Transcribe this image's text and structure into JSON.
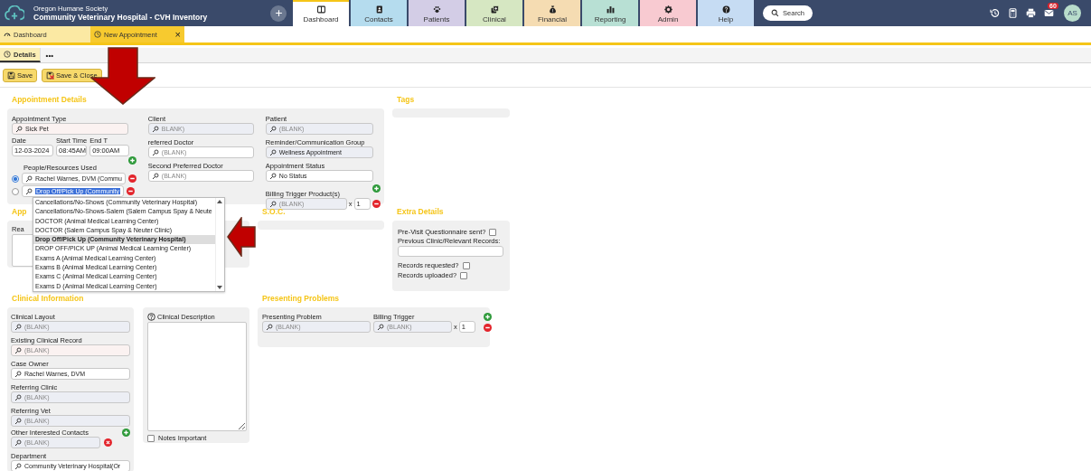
{
  "header": {
    "org": "Oregon Humane Society",
    "site": "Community Veterinary Hospital - CVH Inventory",
    "nav": [
      {
        "label": "Dashboard",
        "selected": true,
        "color": "#ffffff"
      },
      {
        "label": "Contacts",
        "selected": false,
        "color": "#b5dcee"
      },
      {
        "label": "Patients",
        "selected": false,
        "color": "#d3cde6"
      },
      {
        "label": "Clinical",
        "selected": false,
        "color": "#d6e7c2"
      },
      {
        "label": "Financial",
        "selected": false,
        "color": "#f5dcb2"
      },
      {
        "label": "Reporting",
        "selected": false,
        "color": "#b8e0d4"
      },
      {
        "label": "Admin",
        "selected": false,
        "color": "#f8cad1"
      },
      {
        "label": "Help",
        "selected": false,
        "color": "#c6dcf3"
      }
    ],
    "search": "Search",
    "mail_count": "60",
    "avatar": "AS"
  },
  "doc_tabs": [
    {
      "label": "Dashboard",
      "selected": false
    },
    {
      "label": "New Appointment",
      "selected": true,
      "close": "×"
    }
  ],
  "sub_tabs": [
    {
      "label": "Details",
      "selected": true
    }
  ],
  "more": "•••",
  "buttons": [
    {
      "label": "Save",
      "kind": "save"
    },
    {
      "label": "Save & Close",
      "kind": "save-close"
    }
  ],
  "appointment_details": {
    "title": "Appointment Details",
    "appointment_type": {
      "label": "Appointment Type",
      "value": "Sick Pet"
    },
    "date": {
      "label": "Date",
      "value": "12-03-2024"
    },
    "start_time": {
      "label": "Start Time",
      "value": "08:45AM"
    },
    "end_time": {
      "label": "End T",
      "value": "09:00AM"
    },
    "resources": {
      "label": "People/Resources Used",
      "rows": [
        {
          "value": "Rachel Warnes, DVM (Commu",
          "selected": true,
          "highlighted": false
        },
        {
          "value": "Drop Off/Pick Up (Community",
          "selected": false,
          "highlighted": true
        }
      ]
    },
    "client": {
      "label": "Client",
      "placeholder": "BLANK)"
    },
    "preferred_doctor": {
      "label": "referred Doctor",
      "placeholder": "(BLANK)"
    },
    "second_doctor": {
      "label": "Second Preferred Doctor",
      "placeholder": "(BLANK)"
    },
    "patient": {
      "label": "Patient",
      "placeholder": "(BLANK)"
    },
    "reminder_group": {
      "label": "Reminder/Communication Group",
      "value": "Wellness Appointment"
    },
    "status": {
      "label": "Appointment Status",
      "value": "No Status"
    },
    "billing": {
      "label": "Billing Trigger Product(s)",
      "placeholder": "(BLANK)",
      "times": "x",
      "quantity": "1"
    }
  },
  "tags": {
    "title": "Tags"
  },
  "reason": {
    "title": "App",
    "label": "Rea"
  },
  "soc": {
    "title": "S.O.C."
  },
  "extra_details": {
    "title": "Extra Details",
    "questionnaire": {
      "label": "Pre-Visit Questionnaire sent?",
      "checked": false
    },
    "previous_records": {
      "label": "Previous Clinic/Relevant Records:"
    },
    "requested": {
      "label": "Records requested?",
      "checked": false
    },
    "uploaded": {
      "label": "Records uploaded?",
      "checked": false
    }
  },
  "clinical_information": {
    "title": "Clinical Information",
    "fields": [
      {
        "label": "Clinical Layout",
        "placeholder": "(BLANK)",
        "kind": "plain"
      },
      {
        "label": "Existing Clinical Record",
        "placeholder": "(BLANK)",
        "kind": "plain"
      },
      {
        "label": "Case Owner",
        "value": "Rachel Warnes, DVM",
        "kind": "plain"
      },
      {
        "label": "Referring Clinic",
        "placeholder": "(BLANK)",
        "kind": "plain"
      },
      {
        "label": "Referring Vet",
        "placeholder": "(BLANK)",
        "kind": "plain"
      },
      {
        "label": "Other Interested Contacts",
        "placeholder": "(BLANK)",
        "kind": "multi"
      },
      {
        "label": "Department",
        "value": "Community Veterinary Hospital(Or",
        "kind": "plain"
      }
    ]
  },
  "clinical_description": {
    "label": "Clinical Description",
    "notes_important": {
      "label": "Notes Important",
      "checked": false
    }
  },
  "presenting_problems": {
    "title": "Presenting Problems",
    "problem": {
      "label": "Presenting Problem",
      "placeholder": "(BLANK)"
    },
    "billing_trigger": {
      "label": "Billing Trigger",
      "placeholder": "(BLANK)",
      "times": "x",
      "quantity": "1"
    }
  },
  "dropdown": {
    "options": [
      {
        "label": "Cancellations/No-Shows (Community Veterinary Hospital)",
        "selected": false
      },
      {
        "label": "Cancellations/No-Shows-Salem (Salem Campus Spay & Neute",
        "selected": false
      },
      {
        "label": "DOCTOR (Animal Medical Learning Center)",
        "selected": false
      },
      {
        "label": "DOCTOR (Salem Campus Spay & Neuter Clinic)",
        "selected": false
      },
      {
        "label": "Drop Off/Pick Up (Community Veterinary Hospital)",
        "selected": true
      },
      {
        "label": "DROP OFF/PICK UP (Animal Medical Learning Center)",
        "selected": false
      },
      {
        "label": "Exams A (Animal Medical Learning Center)",
        "selected": false
      },
      {
        "label": "Exams B (Animal Medical Learning Center)",
        "selected": false
      },
      {
        "label": "Exams C (Animal Medical Learning Center)",
        "selected": false
      },
      {
        "label": "Exams D (Animal Medical Learning Center)",
        "selected": false
      }
    ]
  }
}
